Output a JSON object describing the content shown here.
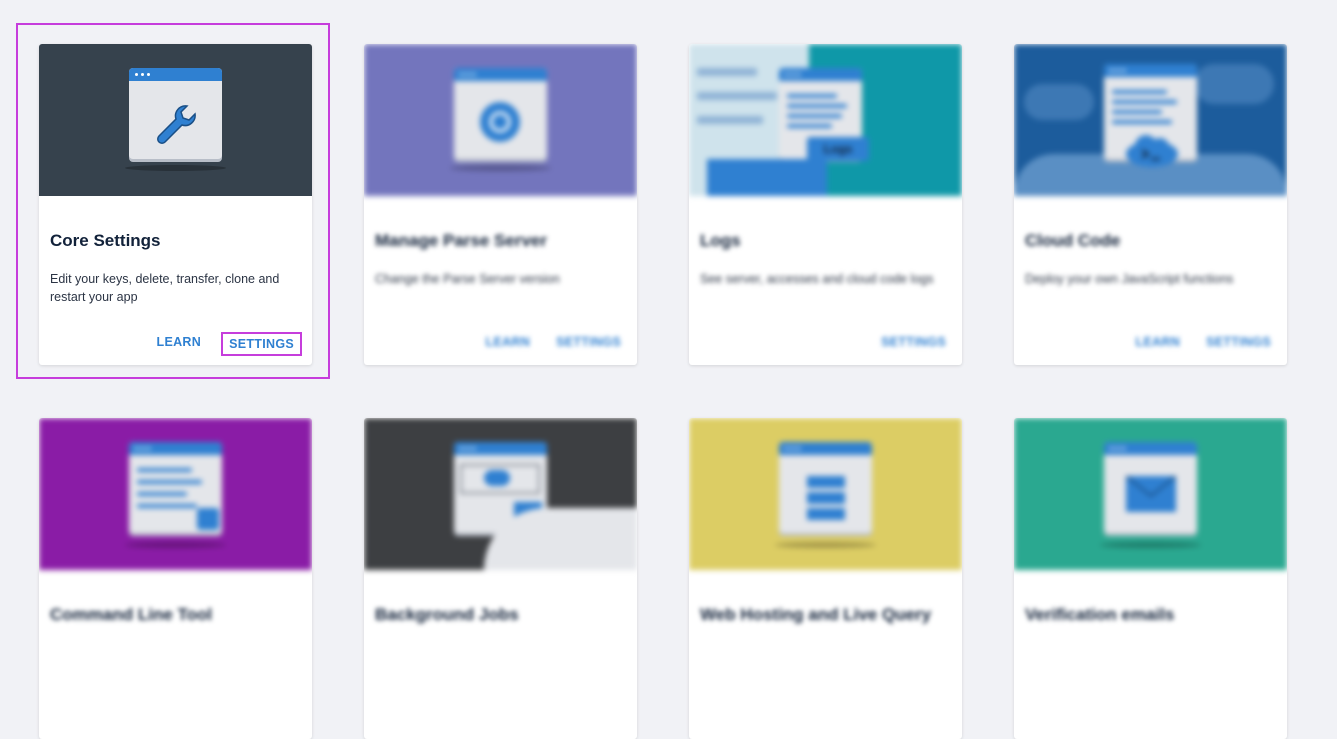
{
  "cards": [
    {
      "title": "Core Settings",
      "description": "Edit your keys, delete, transfer, clone and restart your app",
      "buttons": [
        "LEARN",
        "SETTINGS"
      ],
      "banner_color": "#36424d",
      "icon": "wrench-icon"
    },
    {
      "title": "Manage Parse Server",
      "description": "Change the Parse Server version",
      "buttons": [
        "LEARN",
        "SETTINGS"
      ],
      "banner_color": "#7375bd",
      "icon": "server-refresh-icon"
    },
    {
      "title": "Logs",
      "description": "See server, accesses and cloud code logs",
      "buttons": [
        "SETTINGS"
      ],
      "banner_color": "#0f98a8",
      "icon": "logs-icon",
      "badge": "Logs"
    },
    {
      "title": "Cloud Code",
      "description": "Deploy your own JavaScript functions",
      "buttons": [
        "LEARN",
        "SETTINGS"
      ],
      "banner_color": "#1c5c9c",
      "icon": "terminal-cloud-icon"
    },
    {
      "title": "Command Line Tool",
      "description": "",
      "buttons": [],
      "banner_color": "#8a1ca6",
      "icon": "command-line-icon"
    },
    {
      "title": "Background Jobs",
      "description": "",
      "buttons": [],
      "banner_color": "#3d3f42",
      "icon": "background-jobs-icon"
    },
    {
      "title": "Web Hosting and Live Query",
      "description": "",
      "buttons": [],
      "banner_color": "#dccd64",
      "icon": "web-hosting-icon"
    },
    {
      "title": "Verification emails",
      "description": "",
      "buttons": [],
      "banner_color": "#2aa890",
      "icon": "envelope-icon"
    }
  ],
  "accent_color": "#2f80d1",
  "highlight_color": "#c63ddc"
}
